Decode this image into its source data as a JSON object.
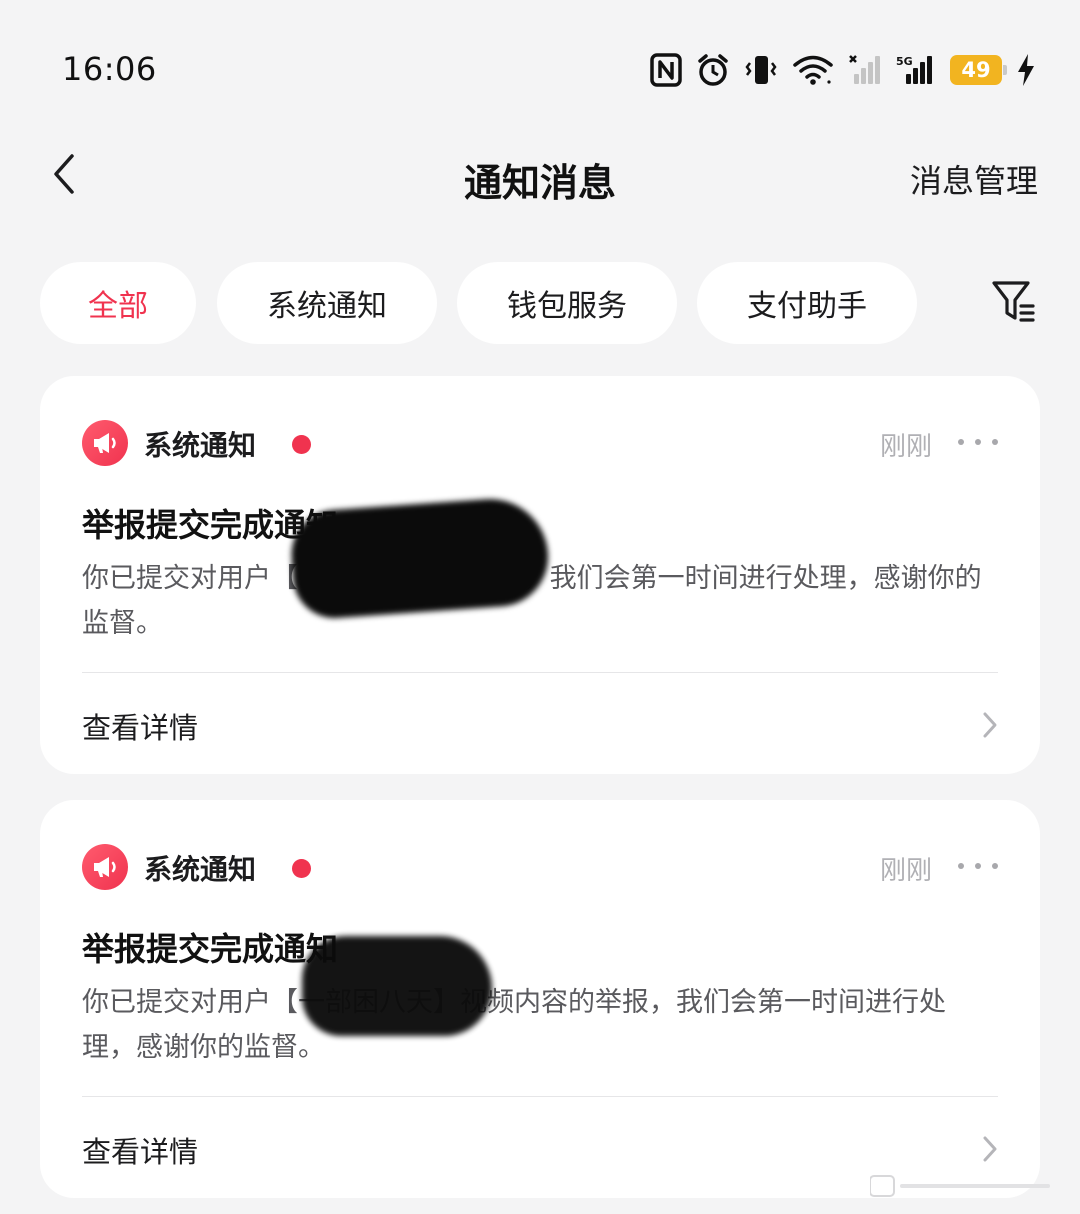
{
  "status_bar": {
    "time": "16:06",
    "battery_level": "49",
    "icons": [
      "nfc-icon",
      "alarm-icon",
      "vibrate-icon",
      "wifi-icon",
      "signal-sim1-icon",
      "signal-5g-icon",
      "battery-icon",
      "charging-icon"
    ],
    "network_label": "5G",
    "battery_color": "#f2b420"
  },
  "header": {
    "title": "通知消息",
    "manage_label": "消息管理"
  },
  "tabs": [
    {
      "label": "全部",
      "active": true
    },
    {
      "label": "系统通知",
      "active": false
    },
    {
      "label": "钱包服务",
      "active": false
    },
    {
      "label": "支付助手",
      "active": false
    }
  ],
  "notifications": [
    {
      "source": "系统通知",
      "time": "刚刚",
      "title": "举报提交完成通知",
      "body": "你已提交对用户【                    】视频内容的举报，我们会第一时间进行处理，感谢你的监督。",
      "details_label": "查看详情",
      "unread": true
    },
    {
      "source": "系统通知",
      "time": "刚刚",
      "title": "举报提交完成通知",
      "body": "你已提交对用户【一部困八天】视频内容的举报，我们会第一时间进行处理，感谢你的监督。",
      "details_label": "查看详情",
      "unread": true
    }
  ],
  "colors": {
    "accent": "#f0334f",
    "background": "#f4f4f5",
    "card": "#ffffff"
  }
}
